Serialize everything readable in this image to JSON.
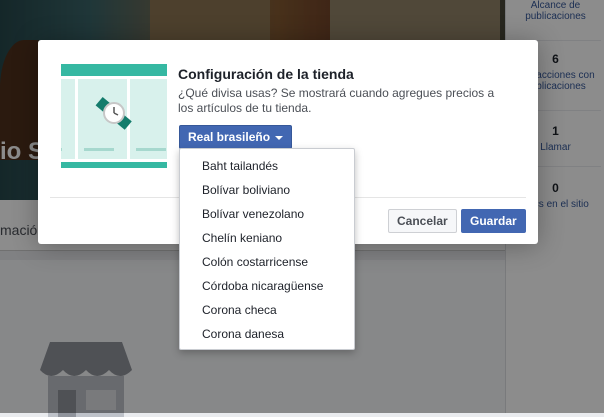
{
  "background": {
    "page_name_fragment": "io S",
    "tab_fragment": "mació",
    "stats": [
      {
        "number": "",
        "label": "Alcance de publicaciones"
      },
      {
        "number": "6",
        "label": "Interacciones con publicaciones"
      },
      {
        "number": "1",
        "label": "Llamar"
      },
      {
        "number": "0",
        "label": "Clics en el sitio"
      }
    ]
  },
  "dialog": {
    "title": "Configuración de la tienda",
    "description": "¿Qué divisa usas? Se mostrará cuando agregues precios a los artículos de tu tienda.",
    "currency_selected": "Real brasileño",
    "cancel_label": "Cancelar",
    "save_label": "Guardar"
  },
  "currency_dropdown": {
    "options": [
      "Baht tailandés",
      "Bolívar boliviano",
      "Bolívar venezolano",
      "Chelín keniano",
      "Colón costarricense",
      "Córdoba nicaragüense",
      "Corona checa",
      "Corona danesa"
    ]
  },
  "colors": {
    "primary": "#4267b2",
    "illustration": "#35b8a2"
  }
}
